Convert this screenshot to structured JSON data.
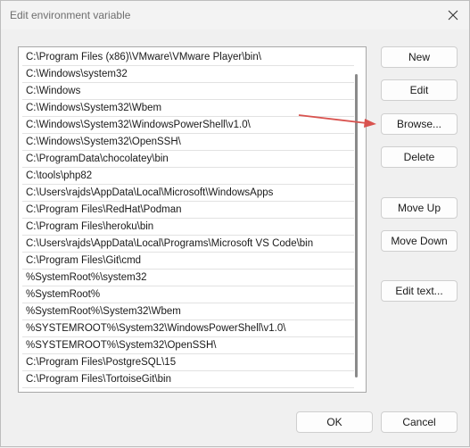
{
  "window": {
    "title": "Edit environment variable"
  },
  "paths": [
    "C:\\Program Files (x86)\\VMware\\VMware Player\\bin\\",
    "C:\\Windows\\system32",
    "C:\\Windows",
    "C:\\Windows\\System32\\Wbem",
    "C:\\Windows\\System32\\WindowsPowerShell\\v1.0\\",
    "C:\\Windows\\System32\\OpenSSH\\",
    "C:\\ProgramData\\chocolatey\\bin",
    "C:\\tools\\php82",
    "C:\\Users\\rajds\\AppData\\Local\\Microsoft\\WindowsApps",
    "C:\\Program Files\\RedHat\\Podman",
    "C:\\Program Files\\heroku\\bin",
    "C:\\Users\\rajds\\AppData\\Local\\Programs\\Microsoft VS Code\\bin",
    "C:\\Program Files\\Git\\cmd",
    "%SystemRoot%\\system32",
    "%SystemRoot%",
    "%SystemRoot%\\System32\\Wbem",
    "%SYSTEMROOT%\\System32\\WindowsPowerShell\\v1.0\\",
    "%SYSTEMROOT%\\System32\\OpenSSH\\",
    "C:\\Program Files\\PostgreSQL\\15",
    "C:\\Program Files\\TortoiseGit\\bin"
  ],
  "buttons": {
    "new": "New",
    "edit": "Edit",
    "browse": "Browse...",
    "delete": "Delete",
    "move_up": "Move Up",
    "move_down": "Move Down",
    "edit_text": "Edit text...",
    "ok": "OK",
    "cancel": "Cancel"
  },
  "annotation": {
    "color": "#d9534f"
  }
}
